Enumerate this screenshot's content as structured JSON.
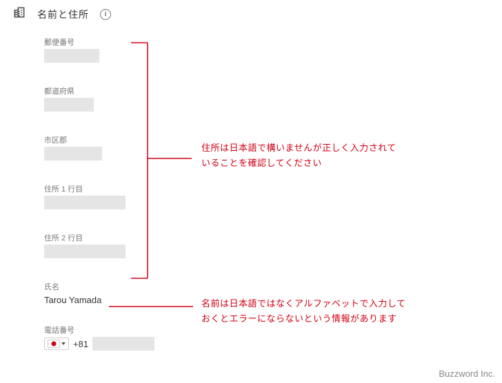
{
  "header": {
    "title": "名前と住所"
  },
  "fields": {
    "postal": {
      "label": "郵便番号"
    },
    "prefecture": {
      "label": "都道府県"
    },
    "city": {
      "label": "市区郡"
    },
    "addr1": {
      "label": "住所 1 行目"
    },
    "addr2": {
      "label": "住所 2 行目"
    },
    "name": {
      "label": "氏名",
      "value": "Tarou Yamada"
    },
    "phone": {
      "label": "電話番号",
      "code": "+81"
    }
  },
  "annotations": {
    "address_line1": "住所は日本語で構いませんが正しく入力されて",
    "address_line2": "いることを確認してください",
    "name_line1": "名前は日本語ではなくアルファベットで入力して",
    "name_line2": "おくとエラーにならないという情報があります"
  },
  "watermark": "Buzzword Inc."
}
